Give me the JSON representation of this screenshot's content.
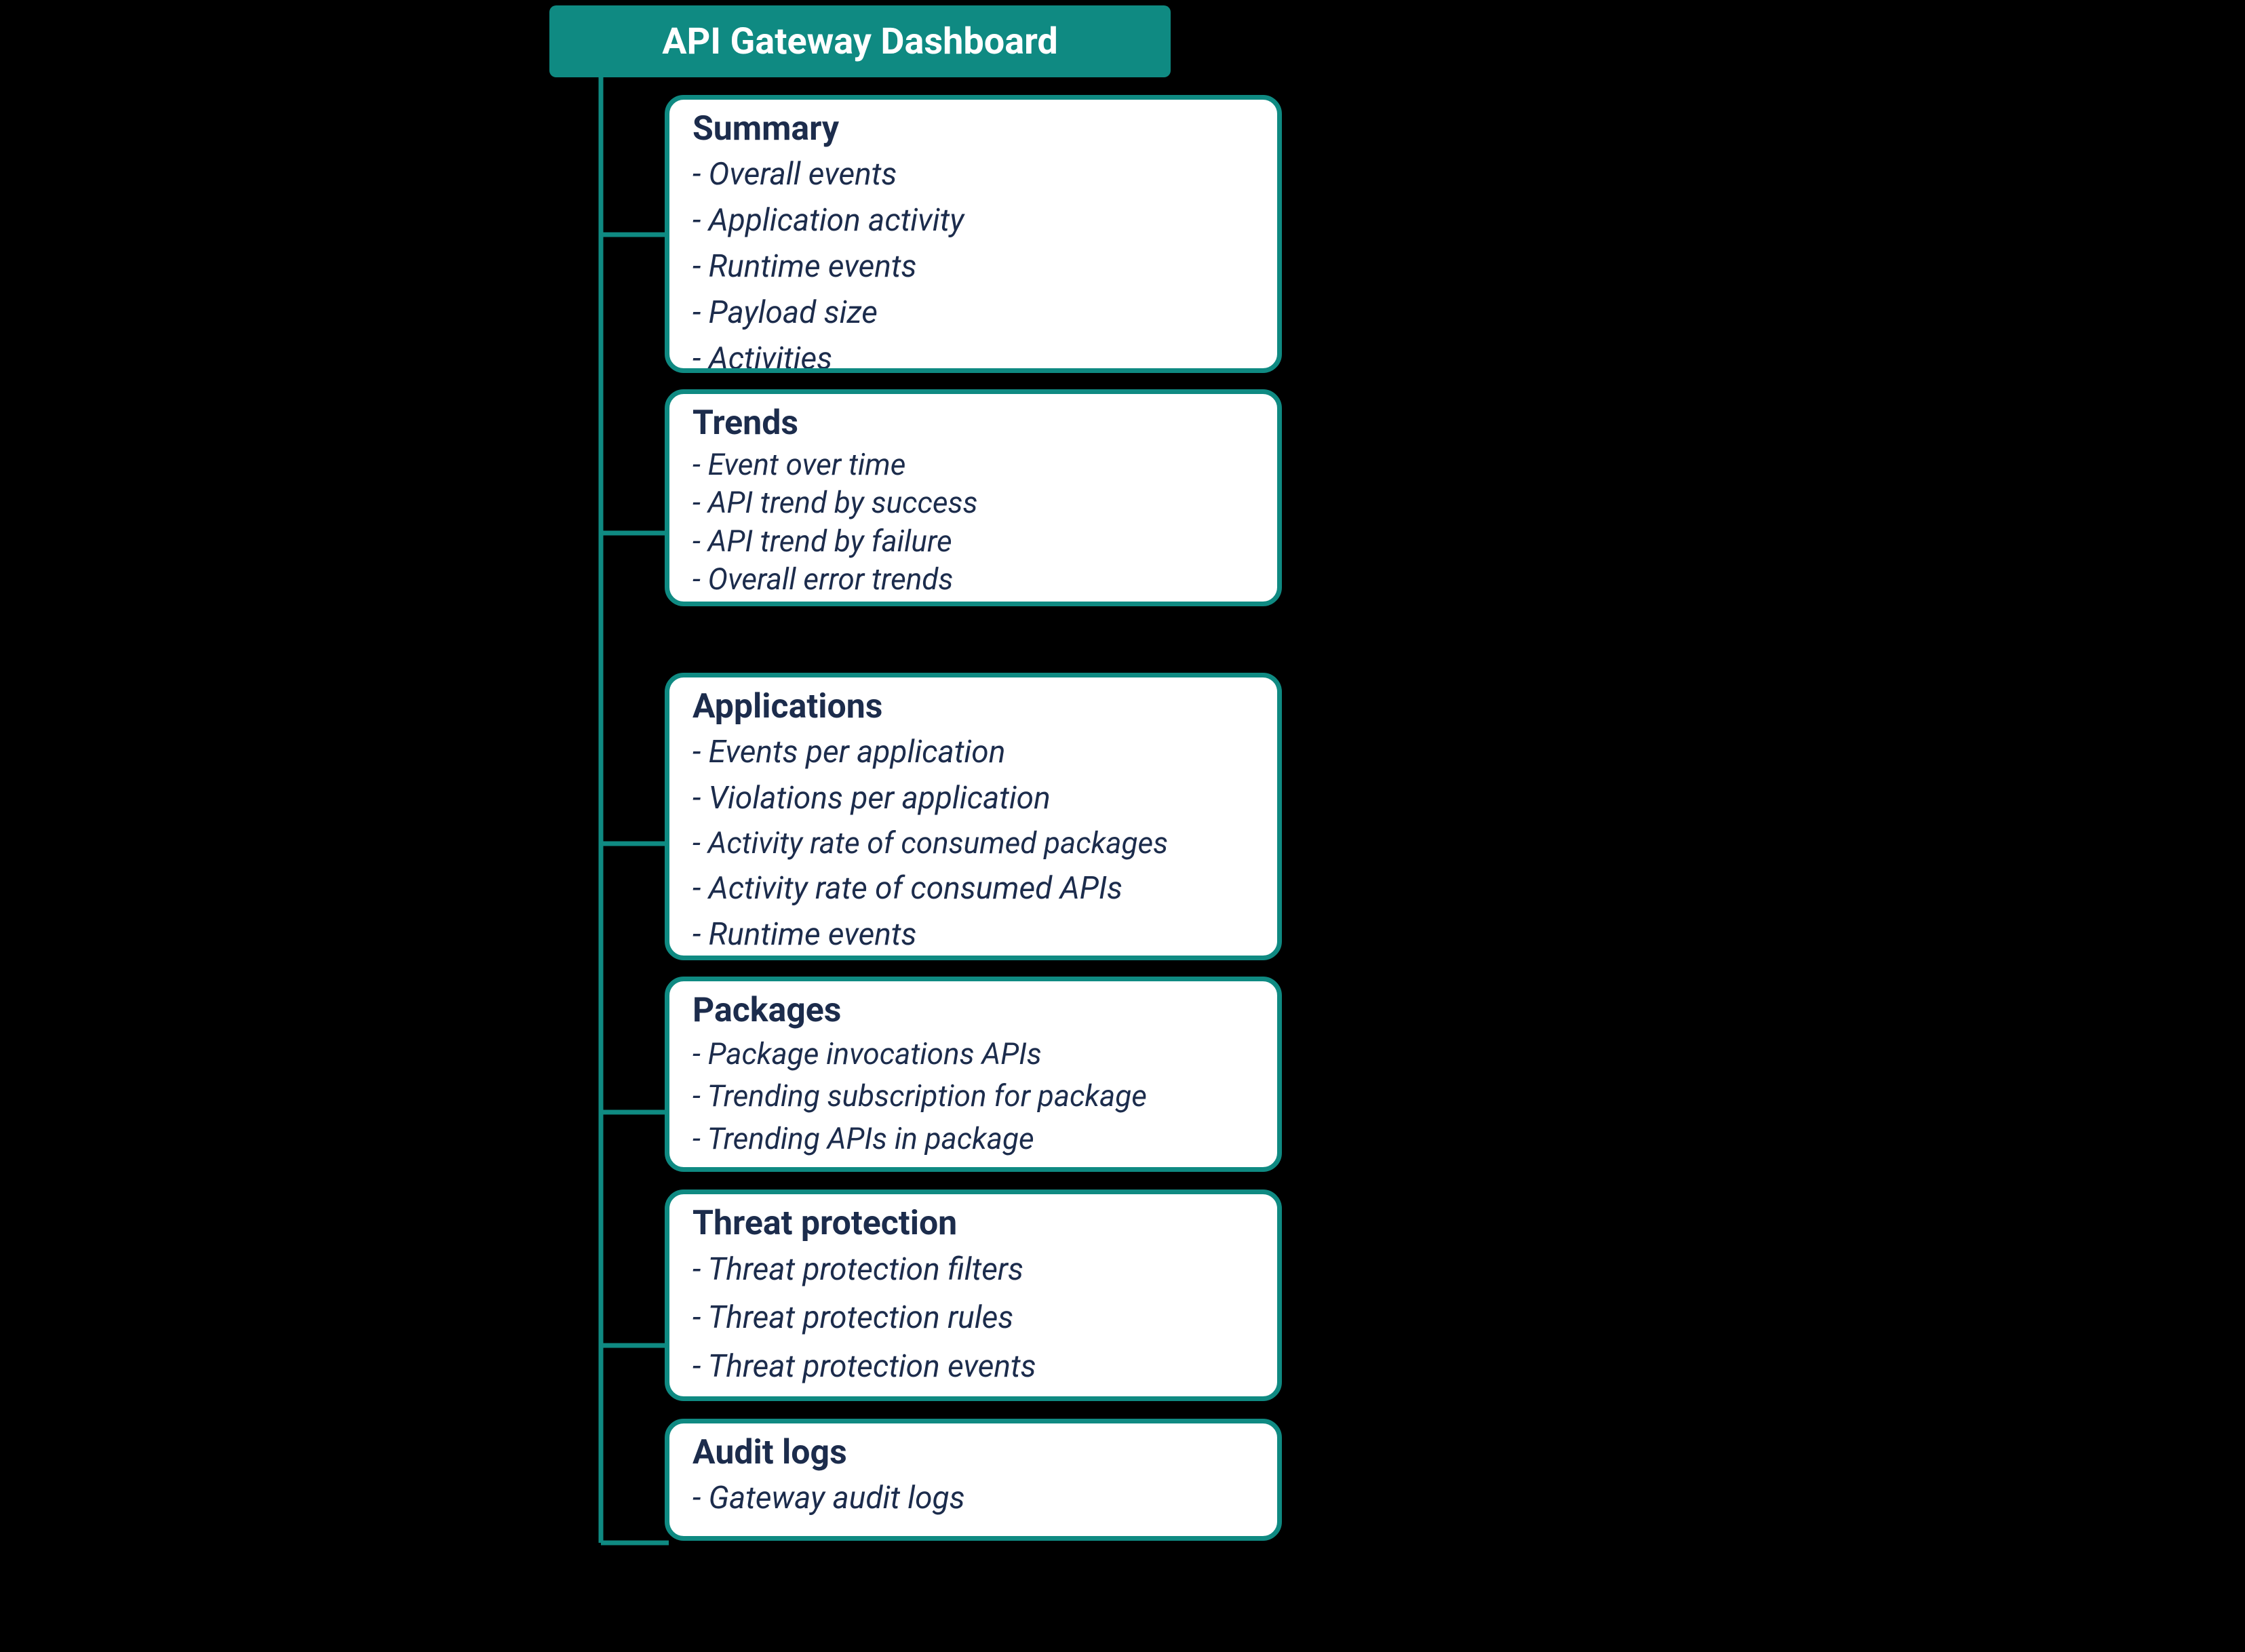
{
  "colors": {
    "teal": "#0f8a82",
    "text": "#1c2c4c",
    "bg": "#000000",
    "card": "#ffffff"
  },
  "root": {
    "title": "API Gateway Dashboard"
  },
  "nodes": [
    {
      "id": "summary",
      "title": "Summary",
      "items": [
        "Overall events",
        "Application activity",
        "Runtime events",
        "Payload size",
        "Activities"
      ]
    },
    {
      "id": "trends",
      "title": "Trends",
      "items": [
        "Event over time",
        "API trend by success",
        "API trend by failure",
        "Overall error trends"
      ]
    },
    {
      "id": "applications",
      "title": "Applications",
      "items": [
        "Events per application",
        "Violations per application",
        "Activity rate of consumed packages",
        "Activity rate of consumed APIs",
        "Runtime events"
      ]
    },
    {
      "id": "packages",
      "title": "Packages",
      "items": [
        "Package invocations APIs",
        "Trending subscription for package",
        "Trending APIs in package"
      ]
    },
    {
      "id": "threat",
      "title": "Threat protection",
      "items": [
        "Threat protection filters",
        "Threat protection rules",
        "Threat protection events"
      ]
    },
    {
      "id": "audit",
      "title": "Audit logs",
      "items": [
        "Gateway audit logs"
      ]
    }
  ]
}
